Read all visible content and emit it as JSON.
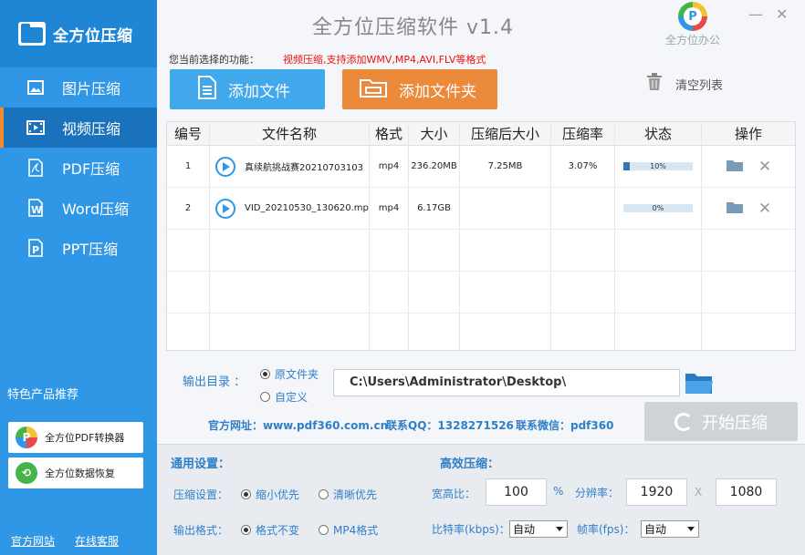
{
  "app": {
    "logo_text": "全方位压缩",
    "title": "全方位压缩软件 v1.4",
    "brand_text": "全方位办公",
    "brand_letter": "P",
    "minimize": "—",
    "close": "✕"
  },
  "sidebar": {
    "items": [
      {
        "label": "图片压缩",
        "icon": "image-icon"
      },
      {
        "label": "视频压缩",
        "icon": "video-icon",
        "active": true
      },
      {
        "label": "PDF压缩",
        "icon": "pdf-icon"
      },
      {
        "label": "Word压缩",
        "icon": "word-icon"
      },
      {
        "label": "PPT压缩",
        "icon": "ppt-icon"
      }
    ],
    "feature_title": "特色产品推荐",
    "promos": [
      "全方位PDF转换器",
      "全方位数据恢复"
    ],
    "links": [
      "官方网站",
      "在线客服"
    ]
  },
  "function": {
    "label": "您当前选择的功能：",
    "value": "视频压缩,支持添加WMV,MP4,AVI,FLV等格式"
  },
  "toolbar": {
    "add_file": "添加文件",
    "add_folder": "添加文件夹",
    "clear_list": "清空列表"
  },
  "table": {
    "headers": [
      "编号",
      "文件名称",
      "格式",
      "大小",
      "压缩后大小",
      "压缩率",
      "状态",
      "操作"
    ],
    "rows": [
      {
        "no": "1",
        "name": "真续航挑战赛20210703103",
        "format": "mp4",
        "size": "236.20MB",
        "after": "7.25MB",
        "ratio": "3.07%",
        "progress": "10%",
        "progress_value": 0.1
      },
      {
        "no": "2",
        "name": "VID_20210530_130620.mp4",
        "format": "mp4",
        "size": "6.17GB",
        "after": "",
        "ratio": "",
        "progress": "0%",
        "progress_value": 0
      }
    ]
  },
  "output": {
    "label": "输出目录 ：",
    "opt_original": "原文件夹",
    "opt_custom": "自定义",
    "path": "C:\\Users\\Administrator\\Desktop\\"
  },
  "info": {
    "website": "官方网址：www.pdf360.com.cn",
    "qq": "联系QQ：1328271526",
    "wechat": "联系微信：pdf360"
  },
  "start_label": "开始压缩",
  "settings": {
    "general_title": "通用设置：",
    "efficient_title": "高效压缩：",
    "compress_label": "压缩设置：",
    "opt_small": "缩小优先",
    "opt_clear": "清晰优先",
    "format_label": "输出格式：",
    "opt_keep": "格式不变",
    "opt_mp4": "MP4格式",
    "ratio_label": "宽高比：",
    "ratio_value": "100",
    "ratio_unit": "%",
    "resolution_label": "分辨率：",
    "res_w": "1920",
    "res_x": "X",
    "res_h": "1080",
    "bitrate_label": "比特率(kbps)：",
    "bitrate_value": "自动",
    "fps_label": "帧率(fps)：",
    "fps_value": "自动"
  },
  "colors": {
    "sidebar": "#2f97e6",
    "active_accent": "#f28b30",
    "add_file": "#42a8ec",
    "add_folder": "#ec8a3c",
    "highlight_text": "#ee1111"
  }
}
